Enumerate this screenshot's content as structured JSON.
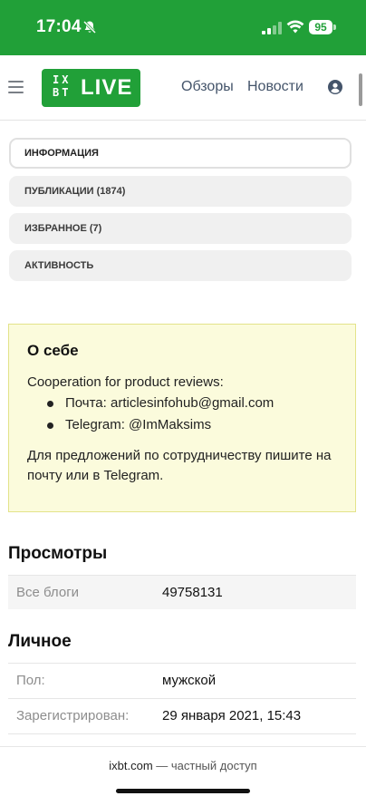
{
  "status_bar": {
    "time": "17:04",
    "battery": "95",
    "icons": [
      "bell-off-icon",
      "signal-icon",
      "wifi-icon",
      "battery-icon"
    ]
  },
  "header": {
    "logo_ix": "IX",
    "logo_bt": "BT",
    "logo_live": "LIVE",
    "nav": [
      "Обзоры",
      "Новости"
    ],
    "icons": [
      "menu-icon",
      "user-icon"
    ]
  },
  "tabs": [
    {
      "label": "ИНФОРМАЦИЯ",
      "active": true
    },
    {
      "label": "ПУБЛИКАЦИИ (1874)",
      "active": false
    },
    {
      "label": "ИЗБРАННОЕ (7)",
      "active": false
    },
    {
      "label": "АКТИВНОСТЬ",
      "active": false
    }
  ],
  "about": {
    "title": "О себе",
    "intro": "Cooperation for product reviews:",
    "items": [
      "Почта: articlesinfohub@gmail.com",
      "Telegram: @ImMaksims"
    ],
    "note": "Для предложений по сотрудничеству пишите на почту или в Telegram."
  },
  "views": {
    "title": "Просмотры",
    "rows": [
      {
        "label": "Все блоги",
        "value": "49758131"
      }
    ]
  },
  "personal": {
    "title": "Личное",
    "rows": [
      {
        "label": "Пол:",
        "value": "мужской"
      },
      {
        "label": "Зарегистрирован:",
        "value": "29 января 2021, 15:43"
      }
    ]
  },
  "footer": {
    "brand": "ixbt.com",
    "text": " — частный доступ"
  },
  "colors": {
    "brand_green": "#21a038",
    "about_bg": "#fbfbdc",
    "about_border": "#e3e38a"
  }
}
